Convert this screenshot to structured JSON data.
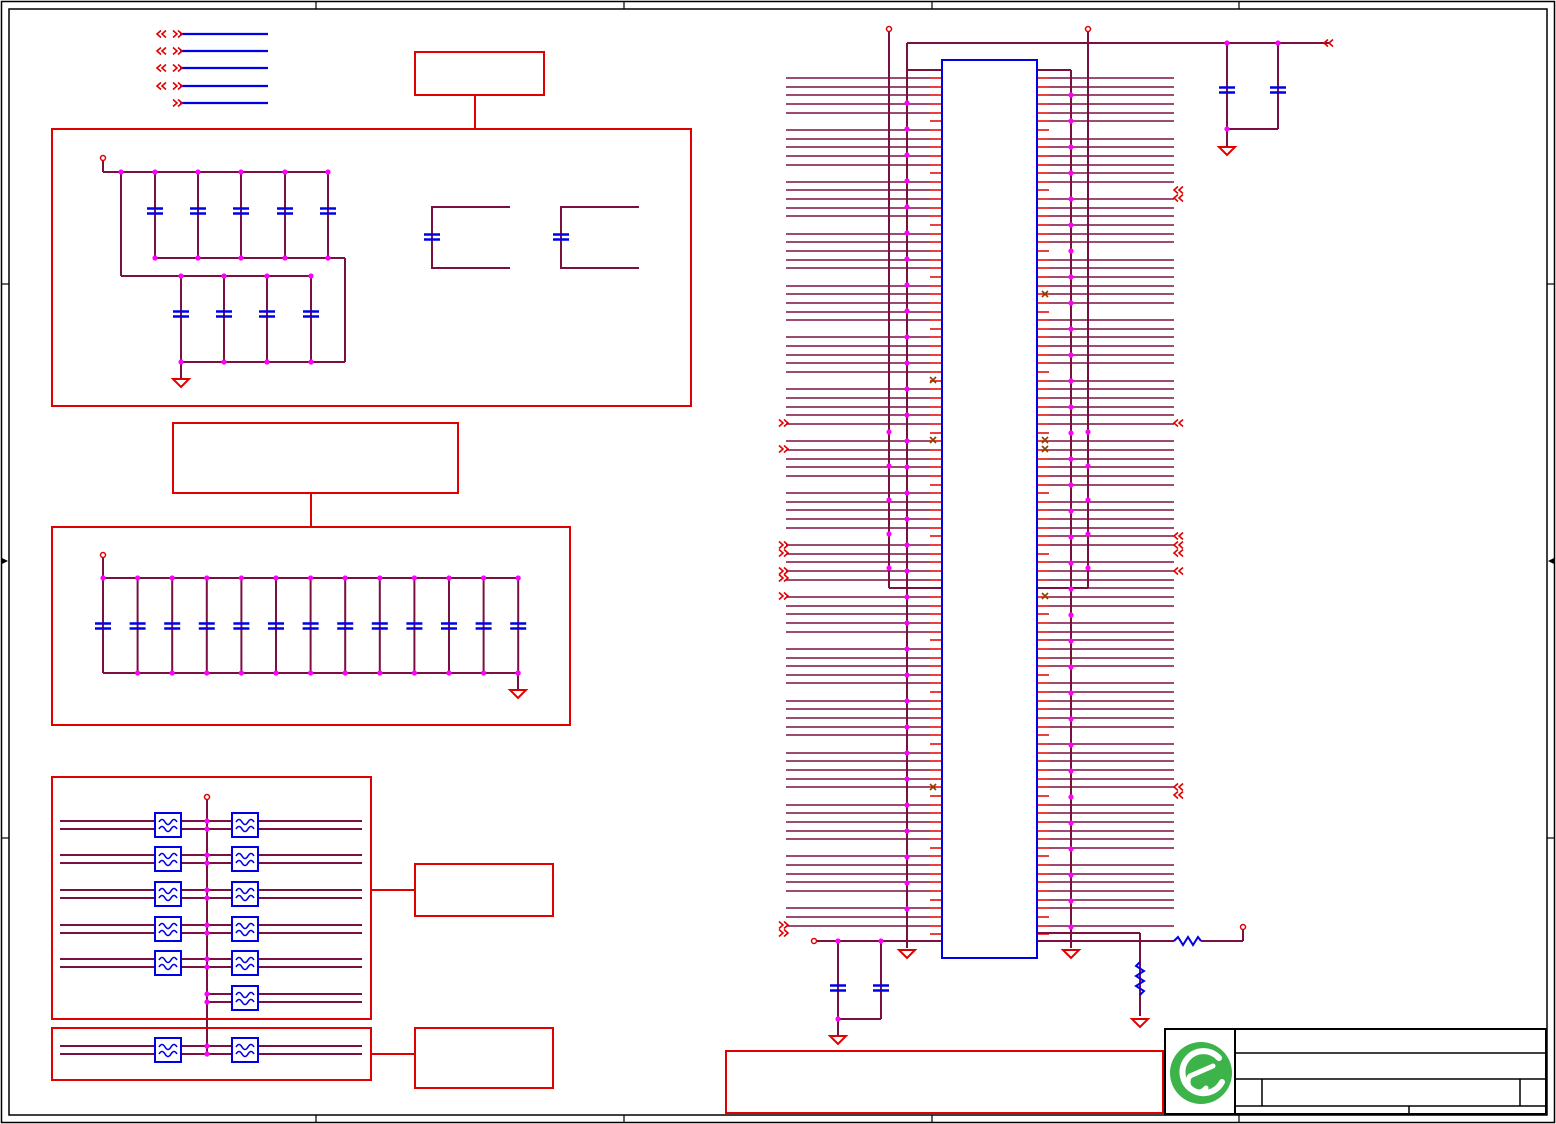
{
  "sheet": {
    "border_color": "#000000",
    "wire_color": "#7a1040",
    "box_color": "#e00000",
    "part_color": "#0000e6",
    "junction_color": "#ff00ff"
  },
  "title_block": {
    "logo": "circle-e-logo",
    "logo_color": "#3cb44a",
    "text_rows": []
  },
  "symbols": [
    "capacitor-icon",
    "ferrite-bead-icon",
    "resistor-icon",
    "ground-icon",
    "power-port-icon",
    "offpage-connector-icon",
    "no-connect-icon"
  ]
}
